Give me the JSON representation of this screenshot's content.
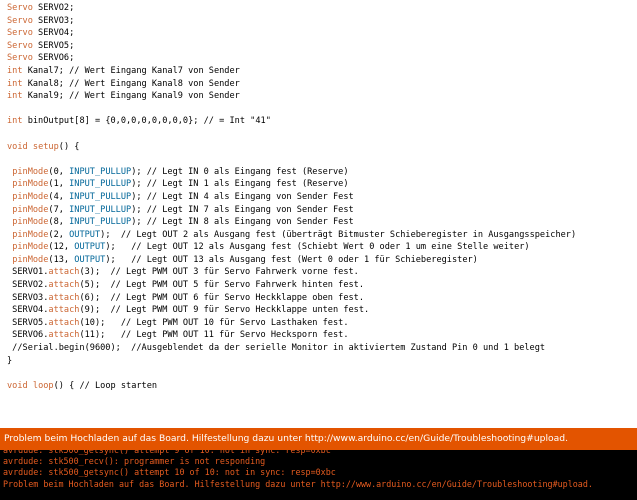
{
  "code_lines": [
    [
      {
        "t": "Servo",
        "c": "ty"
      },
      {
        "t": " SERVO2;"
      }
    ],
    [
      {
        "t": "Servo",
        "c": "ty"
      },
      {
        "t": " SERVO3;"
      }
    ],
    [
      {
        "t": "Servo",
        "c": "ty"
      },
      {
        "t": " SERVO4;"
      }
    ],
    [
      {
        "t": "Servo",
        "c": "ty"
      },
      {
        "t": " SERVO5;"
      }
    ],
    [
      {
        "t": "Servo",
        "c": "ty"
      },
      {
        "t": " SERVO6;"
      }
    ],
    [
      {
        "t": "int",
        "c": "kw"
      },
      {
        "t": " Kanal7; // Wert Eingang Kanal7 von Sender"
      }
    ],
    [
      {
        "t": "int",
        "c": "kw"
      },
      {
        "t": " Kanal8; // Wert Eingang Kanal8 von Sender"
      }
    ],
    [
      {
        "t": "int",
        "c": "kw"
      },
      {
        "t": " Kanal9; // Wert Eingang Kanal9 von Sender"
      }
    ],
    [
      {
        "t": ""
      }
    ],
    [
      {
        "t": "int",
        "c": "kw"
      },
      {
        "t": " binOutput[8] = {0,0,0,0,0,0,0,0}; // = Int \"41\""
      }
    ],
    [
      {
        "t": ""
      }
    ],
    [
      {
        "t": "void",
        "c": "kw"
      },
      {
        "t": " "
      },
      {
        "t": "setup",
        "c": "fn"
      },
      {
        "t": "() {"
      }
    ],
    [
      {
        "t": ""
      }
    ],
    [
      {
        "t": " "
      },
      {
        "t": "pinMode",
        "c": "fn"
      },
      {
        "t": "(0, "
      },
      {
        "t": "INPUT_PULLUP",
        "c": "cn"
      },
      {
        "t": "); // Legt IN 0 als Eingang fest (Reserve)"
      }
    ],
    [
      {
        "t": " "
      },
      {
        "t": "pinMode",
        "c": "fn"
      },
      {
        "t": "(1, "
      },
      {
        "t": "INPUT_PULLUP",
        "c": "cn"
      },
      {
        "t": "); // Legt IN 1 als Eingang fest (Reserve)"
      }
    ],
    [
      {
        "t": " "
      },
      {
        "t": "pinMode",
        "c": "fn"
      },
      {
        "t": "(4, "
      },
      {
        "t": "INPUT_PULLUP",
        "c": "cn"
      },
      {
        "t": "); // Legt IN 4 als Eingang von Sender Fest"
      }
    ],
    [
      {
        "t": " "
      },
      {
        "t": "pinMode",
        "c": "fn"
      },
      {
        "t": "(7, "
      },
      {
        "t": "INPUT_PULLUP",
        "c": "cn"
      },
      {
        "t": "); // Legt IN 7 als Eingang von Sender Fest"
      }
    ],
    [
      {
        "t": " "
      },
      {
        "t": "pinMode",
        "c": "fn"
      },
      {
        "t": "(8, "
      },
      {
        "t": "INPUT_PULLUP",
        "c": "cn"
      },
      {
        "t": "); // Legt IN 8 als Eingang von Sender Fest"
      }
    ],
    [
      {
        "t": " "
      },
      {
        "t": "pinMode",
        "c": "fn"
      },
      {
        "t": "(2, "
      },
      {
        "t": "OUTPUT",
        "c": "cn"
      },
      {
        "t": ");  // Legt OUT 2 als Ausgang fest (überträgt Bitmuster Schieberegister in Ausgangsspeicher)"
      }
    ],
    [
      {
        "t": " "
      },
      {
        "t": "pinMode",
        "c": "fn"
      },
      {
        "t": "(12, "
      },
      {
        "t": "OUTPUT",
        "c": "cn"
      },
      {
        "t": ");   // Legt OUT 12 als Ausgang fest (Schiebt Wert 0 oder 1 um eine Stelle weiter)"
      }
    ],
    [
      {
        "t": " "
      },
      {
        "t": "pinMode",
        "c": "fn"
      },
      {
        "t": "(13, "
      },
      {
        "t": "OUTPUT",
        "c": "cn"
      },
      {
        "t": ");   // Legt OUT 13 als Ausgang fest (Wert 0 oder 1 für Schieberegister)"
      }
    ],
    [
      {
        "t": " SERVO1."
      },
      {
        "t": "attach",
        "c": "fn"
      },
      {
        "t": "(3);  // Legt PWM OUT 3 für Servo Fahrwerk vorne fest."
      }
    ],
    [
      {
        "t": " SERVO2."
      },
      {
        "t": "attach",
        "c": "fn"
      },
      {
        "t": "(5);  // Legt PWM OUT 5 für Servo Fahrwerk hinten fest."
      }
    ],
    [
      {
        "t": " SERVO3."
      },
      {
        "t": "attach",
        "c": "fn"
      },
      {
        "t": "(6);  // Legt PWM OUT 6 für Servo Heckklappe oben fest."
      }
    ],
    [
      {
        "t": " SERVO4."
      },
      {
        "t": "attach",
        "c": "fn"
      },
      {
        "t": "(9);  // Legt PWM OUT 9 für Servo Heckklappe unten fest."
      }
    ],
    [
      {
        "t": " SERVO5."
      },
      {
        "t": "attach",
        "c": "fn"
      },
      {
        "t": "(10);   // Legt PWM OUT 10 für Servo Lasthaken fest."
      }
    ],
    [
      {
        "t": " SERVO6."
      },
      {
        "t": "attach",
        "c": "fn"
      },
      {
        "t": "(11);   // Legt PWM OUT 11 für Servo Hecksporn fest."
      }
    ],
    [
      {
        "t": " //Serial.begin(9600);  //Ausgeblendet da der serielle Monitor in aktiviertem Zustand Pin 0 und 1 belegt"
      }
    ],
    [
      {
        "t": "}"
      }
    ],
    [
      {
        "t": ""
      }
    ],
    [
      {
        "t": "void",
        "c": "kw"
      },
      {
        "t": " "
      },
      {
        "t": "loop",
        "c": "fn"
      },
      {
        "t": "() { // Loop starten"
      }
    ]
  ],
  "status_bar": {
    "message": "Problem beim Hochladen auf das Board. Hilfestellung dazu unter http://www.arduino.cc/en/Guide/Troubleshooting#upload.",
    "color": "#e35400"
  },
  "console": {
    "lines": [
      "avrdude: stk500_getsync() attempt 9 of 10: not in sync: resp=0xbc",
      "avrdude: stk500_recv(): programmer is not responding",
      "avrdude: stk500_getsync() attempt 10 of 10: not in sync: resp=0xbc",
      "Problem beim Hochladen auf das Board. Hilfestellung dazu unter http://www.arduino.cc/en/Guide/Troubleshooting#upload."
    ],
    "text_color": "#e55b1f"
  }
}
